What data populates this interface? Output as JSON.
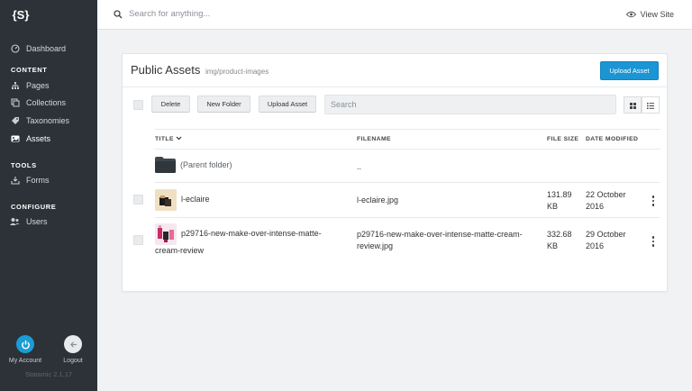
{
  "sidebar": {
    "logo": "{S}",
    "items": [
      {
        "label": "Dashboard",
        "icon": "dashboard-icon"
      },
      {
        "label": "Pages",
        "icon": "pages-icon"
      },
      {
        "label": "Collections",
        "icon": "collections-icon"
      },
      {
        "label": "Taxonomies",
        "icon": "tag-icon"
      },
      {
        "label": "Assets",
        "icon": "assets-icon",
        "active": true
      },
      {
        "label": "Forms",
        "icon": "forms-icon"
      },
      {
        "label": "Users",
        "icon": "users-icon"
      }
    ],
    "sections": {
      "content": "CONTENT",
      "tools": "TOOLS",
      "configure": "CONFIGURE"
    },
    "my_account": "My Account",
    "logout": "Logout",
    "version": "Statamic 2.1.17"
  },
  "topbar": {
    "search_placeholder": "Search for anything...",
    "view_site": "View Site"
  },
  "assets": {
    "title": "Public Assets",
    "subtitle": "img/product-images",
    "upload_primary": "Upload Asset",
    "toolbar": {
      "delete": "Delete",
      "new_folder": "New Folder",
      "upload": "Upload Asset",
      "search_placeholder": "Search"
    },
    "columns": {
      "title": "TITLE",
      "filename": "FILENAME",
      "file_size": "FILE SIZE",
      "date_modified": "DATE MODIFIED"
    },
    "parent_folder": {
      "title": "(Parent folder)",
      "filename": ".."
    },
    "rows": [
      {
        "title": "l-eclaire",
        "filename": "l-eclaire.jpg",
        "size_line1": "131.89",
        "size_line2": "KB",
        "date_line1": "22 October",
        "date_line2": "2016"
      },
      {
        "title_line1": "p29716-new-make-over-intense-matte-",
        "title_line2": "cream-review",
        "filename_line1": "p29716-new-make-over-intense-matte-cream-",
        "filename_line2": "review.jpg",
        "size_line1": "332.68",
        "size_line2": "KB",
        "date_line1": "29 October",
        "date_line2": "2016"
      }
    ]
  },
  "colors": {
    "sidebar_bg": "#2c3238",
    "accent": "#1b95d4",
    "page_bg": "#f1f2f4"
  }
}
